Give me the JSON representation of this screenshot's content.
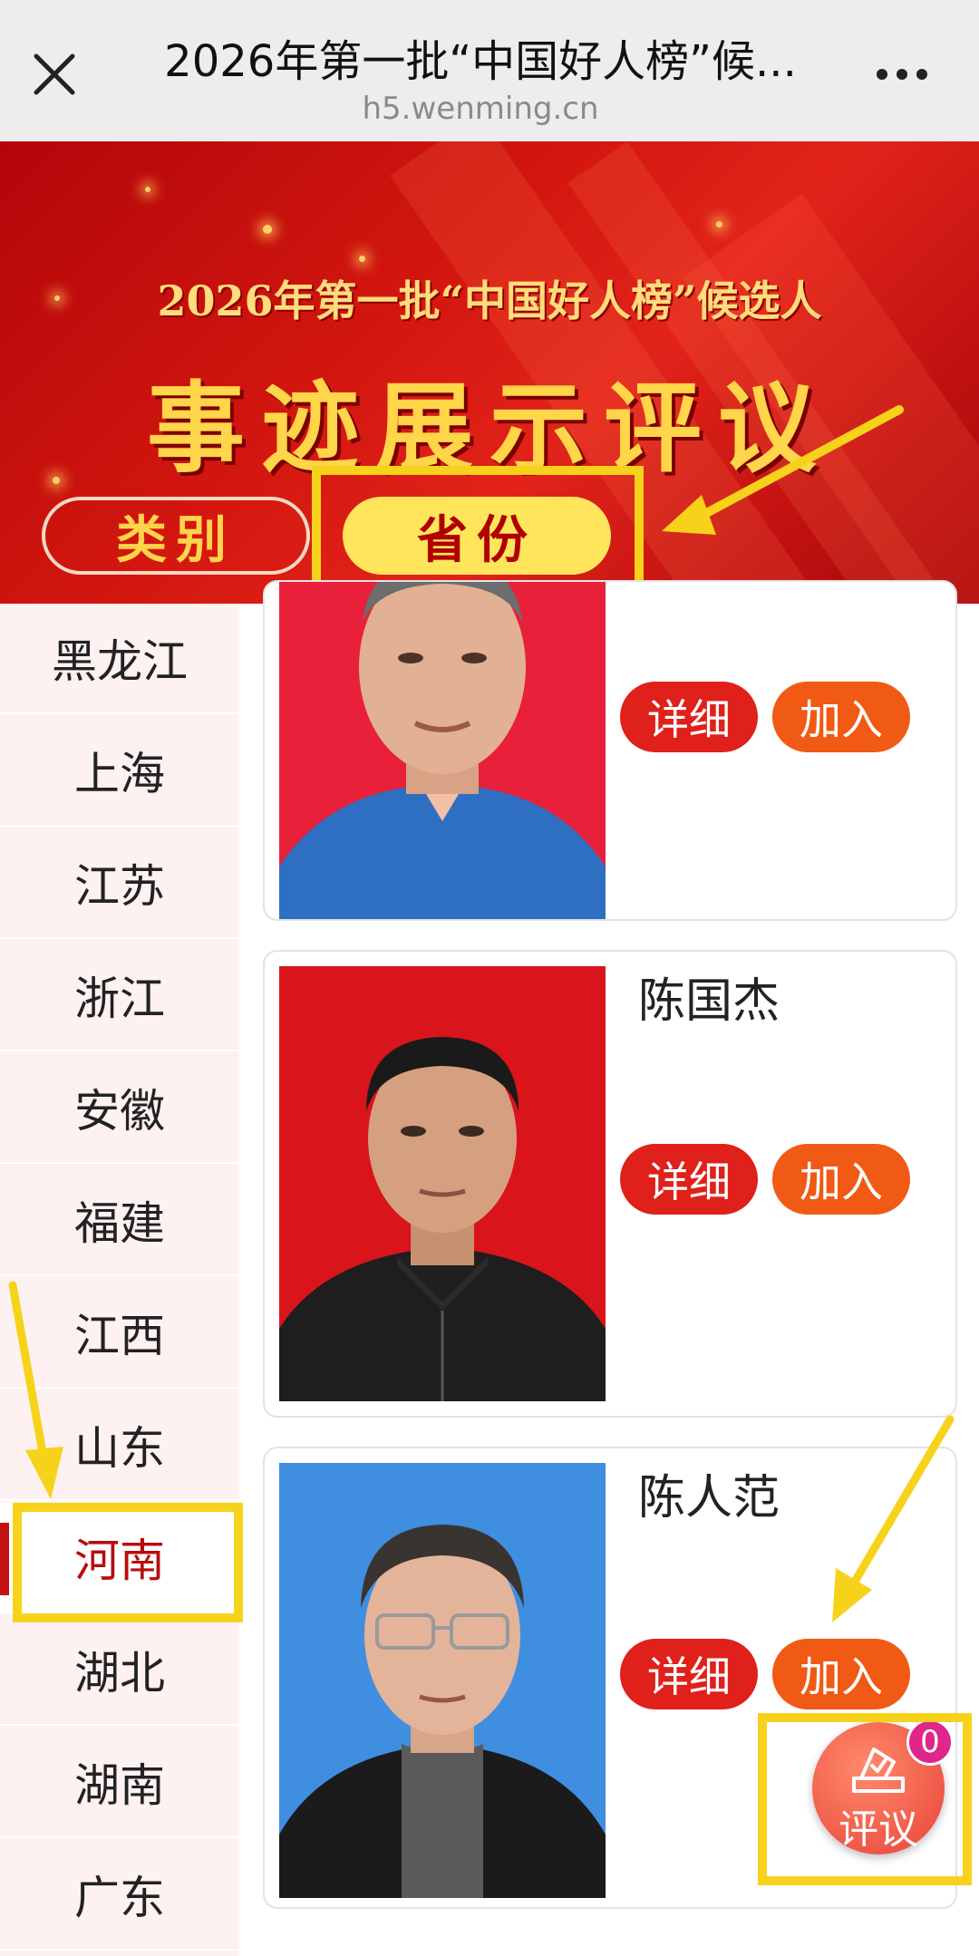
{
  "topbar": {
    "title": "2026年第一批“中国好人榜”候...",
    "url": "h5.wenming.cn"
  },
  "banner": {
    "subtitle": "2026年第一批“中国好人榜”候选人",
    "title": "事迹展示评议",
    "tabs": [
      {
        "label": "类别",
        "active": false
      },
      {
        "label": "省份",
        "active": true
      }
    ]
  },
  "sidebar": {
    "items": [
      {
        "label": "黑龙江"
      },
      {
        "label": "上海"
      },
      {
        "label": "江苏"
      },
      {
        "label": "浙江"
      },
      {
        "label": "安徽"
      },
      {
        "label": "福建"
      },
      {
        "label": "江西"
      },
      {
        "label": "山东"
      },
      {
        "label": "河南",
        "active": true
      },
      {
        "label": "湖北"
      },
      {
        "label": "湖南"
      },
      {
        "label": "广东"
      }
    ]
  },
  "candidates": [
    {
      "name": "",
      "detail_label": "详细",
      "join_label": "加入",
      "photo_bg": "#e8203a"
    },
    {
      "name": "陈国杰",
      "detail_label": "详细",
      "join_label": "加入",
      "photo_bg": "#d9141b"
    },
    {
      "name": "陈人范",
      "detail_label": "详细",
      "join_label": "加入",
      "photo_bg": "#3f8ee0"
    }
  ],
  "fab": {
    "label": "评议",
    "badge": "0"
  },
  "colors": {
    "accent_red": "#e0201a",
    "join_orange": "#f05a14",
    "highlight_yellow": "#f7d21a",
    "sidebar_bg": "#fdf2f1"
  }
}
